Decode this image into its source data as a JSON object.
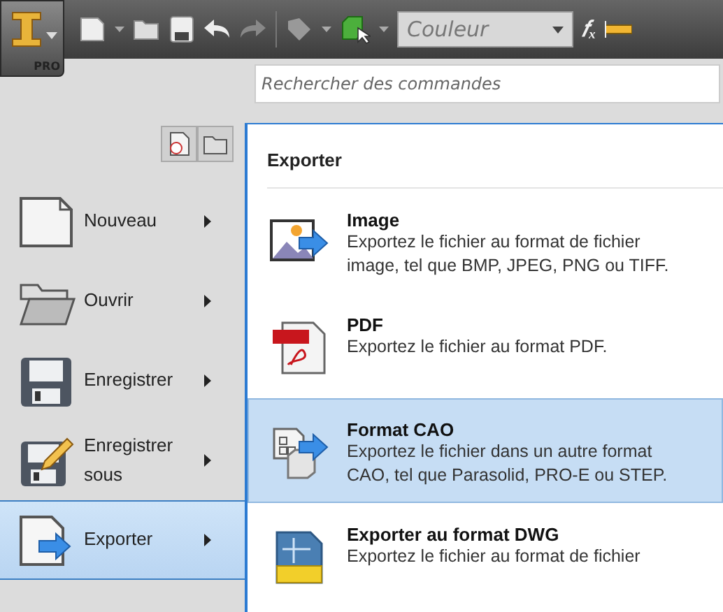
{
  "app_button": {
    "label": "PRO"
  },
  "toolbar": {
    "color_dropdown": {
      "value": "Couleur"
    },
    "function_button": {
      "label": "𝑓ₓ"
    }
  },
  "search": {
    "placeholder": "Rechercher des commandes"
  },
  "menu": {
    "items": [
      {
        "kind": "new",
        "label": "Nouveau",
        "selected": false
      },
      {
        "kind": "open",
        "label": "Ouvrir",
        "selected": false
      },
      {
        "kind": "save",
        "label": "Enregistrer",
        "selected": false
      },
      {
        "kind": "save-as",
        "label": "Enregistrer sous",
        "selected": false
      },
      {
        "kind": "export",
        "label": "Exporter",
        "selected": true
      }
    ]
  },
  "panel": {
    "title": "Exporter",
    "items": [
      {
        "kind": "image",
        "title": "Image",
        "description": "Exportez le fichier au format de fichier image, tel que BMP, JPEG, PNG ou TIFF.",
        "selected": false
      },
      {
        "kind": "pdf",
        "title": "PDF",
        "description": "Exportez le fichier au format PDF.",
        "selected": false
      },
      {
        "kind": "cad",
        "title": "Format CAO",
        "description": "Exportez le fichier dans un autre format CAO, tel que Parasolid, PRO-E ou STEP.",
        "selected": true
      },
      {
        "kind": "dwg",
        "title": "Exporter au format DWG",
        "description": "Exportez le fichier au format de fichier",
        "selected": false
      }
    ]
  }
}
